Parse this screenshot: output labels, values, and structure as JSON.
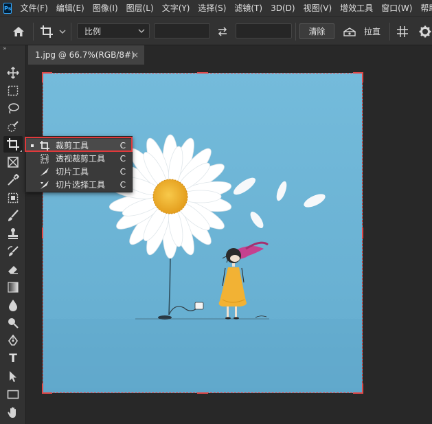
{
  "app": {
    "logo": "Ps"
  },
  "menu": {
    "items": [
      "文件(F)",
      "编辑(E)",
      "图像(I)",
      "图层(L)",
      "文字(Y)",
      "选择(S)",
      "滤镜(T)",
      "3D(D)",
      "视图(V)",
      "增效工具",
      "窗口(W)",
      "帮助(H)"
    ]
  },
  "options": {
    "home_icon": "home-icon",
    "tool_icon": "crop-icon",
    "ratio_value": "比例",
    "swap_icon": "swap-arrows-icon",
    "clear_label": "清除",
    "straighten_icon": "level-icon",
    "straighten_label": "拉直",
    "grid_icon": "grid-icon",
    "settings_icon": "gear-icon"
  },
  "tab": {
    "title": "1.jpg @ 66.7%(RGB/8#)",
    "close": "×"
  },
  "toolbar": {
    "collapse": "»",
    "tools": [
      "move-icon",
      "marquee-icon",
      "lasso-icon",
      "quick-select-icon",
      "crop-icon",
      "frame-icon",
      "eyedropper-icon",
      "patch-icon",
      "brush-icon",
      "stamp-icon",
      "history-brush-icon",
      "eraser-icon",
      "gradient-icon",
      "blur-icon",
      "dodge-icon",
      "pen-icon",
      "type-icon",
      "path-select-icon",
      "rectangle-icon",
      "hand-icon"
    ],
    "type_glyph": "T"
  },
  "flyout": {
    "items": [
      {
        "label": "裁剪工具",
        "key": "C",
        "icon": "crop-icon",
        "selected": true
      },
      {
        "label": "透视裁剪工具",
        "key": "C",
        "icon": "perspective-crop-icon",
        "selected": false
      },
      {
        "label": "切片工具",
        "key": "C",
        "icon": "slice-icon",
        "selected": false
      },
      {
        "label": "切片选择工具",
        "key": "C",
        "icon": "slice-select-icon",
        "selected": false
      }
    ]
  },
  "colors": {
    "accent_red": "#e0393b",
    "image_sky": "#6fb6d6",
    "dress": "#f2b234",
    "hair_ribbon": "#c5418f"
  }
}
